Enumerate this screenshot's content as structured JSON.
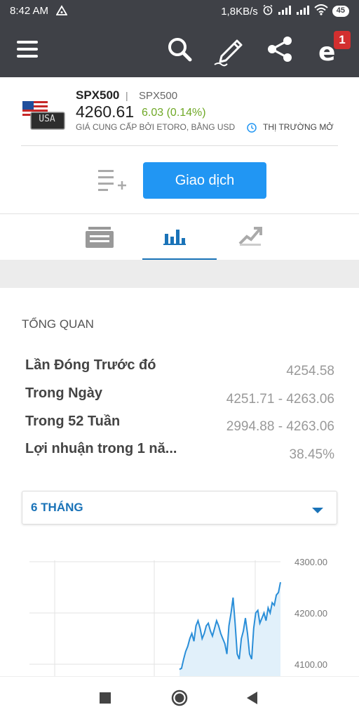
{
  "status_bar": {
    "time": "8:42 AM",
    "network_speed": "1,8KB/s",
    "battery": "45"
  },
  "app_bar": {
    "icons": [
      "menu-icon",
      "search-icon",
      "edit-icon",
      "share-icon",
      "etoro-icon"
    ],
    "notification_count": "1"
  },
  "instrument": {
    "symbol": "SPX500",
    "separator": "|",
    "symbol_secondary": "SPX500",
    "price": "4260.61",
    "change": "6.03 (0.14%)",
    "provided_by": "GIÁ CUNG CẤP BỞI ETORO, BẰNG USD",
    "market_status": "THỊ TRƯỜNG MỞ",
    "flag_label": "USA"
  },
  "actions": {
    "trade_label": "Giao dịch"
  },
  "overview": {
    "title": "TỔNG QUAN",
    "rows": [
      {
        "label": "Lần Đóng Trước đó",
        "value": "4254.58"
      },
      {
        "label": "Trong Ngày",
        "value": "4251.71 - 4263.06"
      },
      {
        "label": "Trong 52 Tuần",
        "value": "2994.88 - 4263.06"
      },
      {
        "label": "Lợi nhuận trong 1 nă...",
        "value": "38.45%"
      }
    ]
  },
  "period_select": {
    "selected": "6 THÁNG"
  },
  "chart_data": {
    "type": "area",
    "y_ticks": [
      "4300.00",
      "4200.00",
      "4100.00"
    ],
    "ylim": [
      4080,
      4300
    ],
    "x": [
      0,
      1,
      2,
      3,
      4,
      5,
      6,
      7,
      8,
      9,
      10,
      11,
      12,
      13,
      14,
      15,
      16,
      17,
      18,
      19,
      20,
      21,
      22,
      23,
      24,
      25,
      26,
      27,
      28,
      29,
      30,
      31,
      32,
      33,
      34,
      35,
      36,
      37,
      38,
      39,
      40,
      41,
      42,
      43,
      44,
      45,
      46,
      47,
      48,
      49
    ],
    "values": [
      4090,
      4092,
      4110,
      4125,
      4135,
      4150,
      4160,
      4145,
      4175,
      4185,
      4170,
      4150,
      4160,
      4175,
      4180,
      4165,
      4155,
      4170,
      4185,
      4175,
      4160,
      4150,
      4140,
      4120,
      4175,
      4200,
      4230,
      4180,
      4120,
      4110,
      4150,
      4165,
      4190,
      4160,
      4120,
      4110,
      4170,
      4200,
      4205,
      4180,
      4190,
      4200,
      4185,
      4210,
      4200,
      4220,
      4215,
      4235,
      4240,
      4260
    ],
    "grid": true,
    "colors": {
      "line": "#2a8ed8",
      "fill": "#e1f0fa"
    }
  },
  "nav": {
    "icons": [
      "recents-icon",
      "home-icon",
      "back-icon"
    ]
  }
}
